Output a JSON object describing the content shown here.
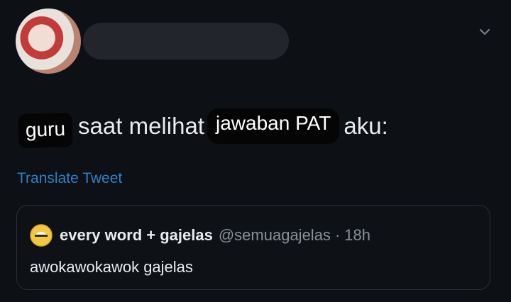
{
  "tweet": {
    "text_parts": {
      "sticker_guru": "guru",
      "middle": "saat melihat",
      "sticker_pat": "jawaban PAT",
      "end": "aku:"
    },
    "translate_label": "Translate Tweet"
  },
  "quoted_tweet": {
    "name": "every word + gajelas",
    "handle": "@semuagajelas",
    "separator": "·",
    "time": "18h",
    "text": "awokawokawok gajelas"
  },
  "colors": {
    "background": "#0d1015",
    "link": "#2f80c8",
    "text": "#e9ecef",
    "muted": "#8a9098"
  },
  "icons": {
    "menu": "chevron-down-icon",
    "quoted_avatar": "emoji-avatar-icon"
  }
}
